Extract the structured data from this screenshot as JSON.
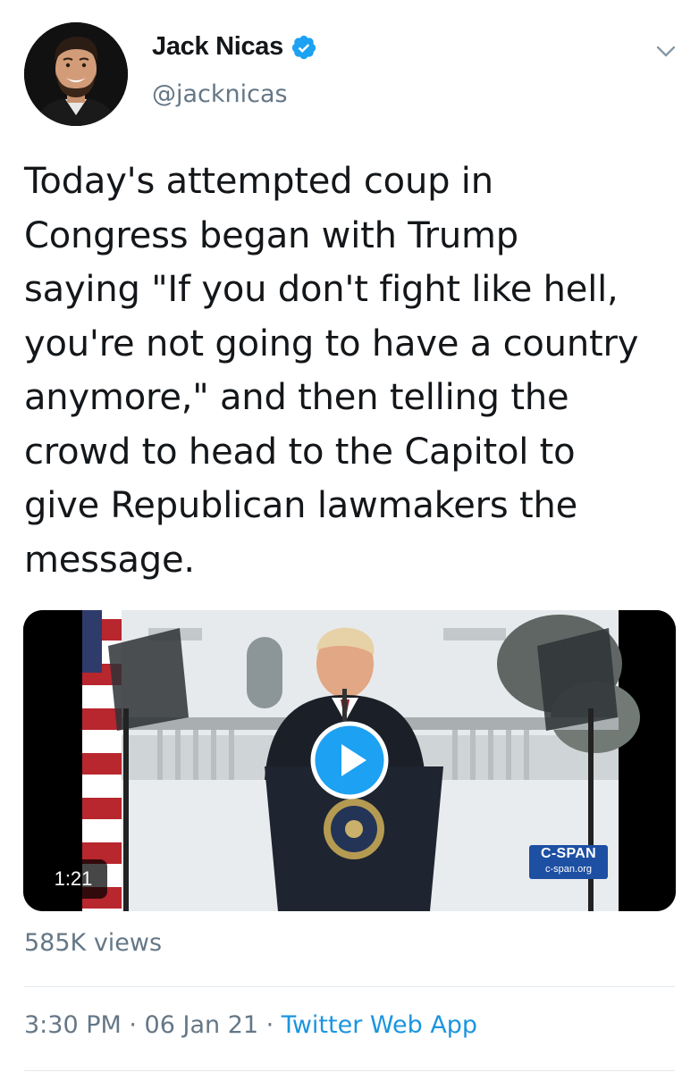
{
  "author": {
    "name": "Jack Nicas",
    "handle": "@jacknicas",
    "verified": true,
    "avatar_icon": "profile-photo"
  },
  "tweet": {
    "text": "Today's attempted coup in\nCongress began with Trump\nsaying \"If you don't fight like hell,\nyou're not going to have a country\nanymore,\" and then telling the\ncrowd to head to the Capitol to\ngive Republican lawmakers the\nmessage."
  },
  "media": {
    "duration": "1:21",
    "watermark_brand": "C-SPAN",
    "watermark_url": "c-span.org",
    "play_icon": "play-icon"
  },
  "stats": {
    "views": "585K views"
  },
  "meta": {
    "time": "3:30 PM",
    "sep1": " · ",
    "date": "06 Jan 21",
    "sep2": " · ",
    "source": "Twitter Web App"
  },
  "colors": {
    "accent": "#1da1f2",
    "link": "#1b95e0",
    "secondary_text": "#657786",
    "primary_text": "#14171a"
  }
}
